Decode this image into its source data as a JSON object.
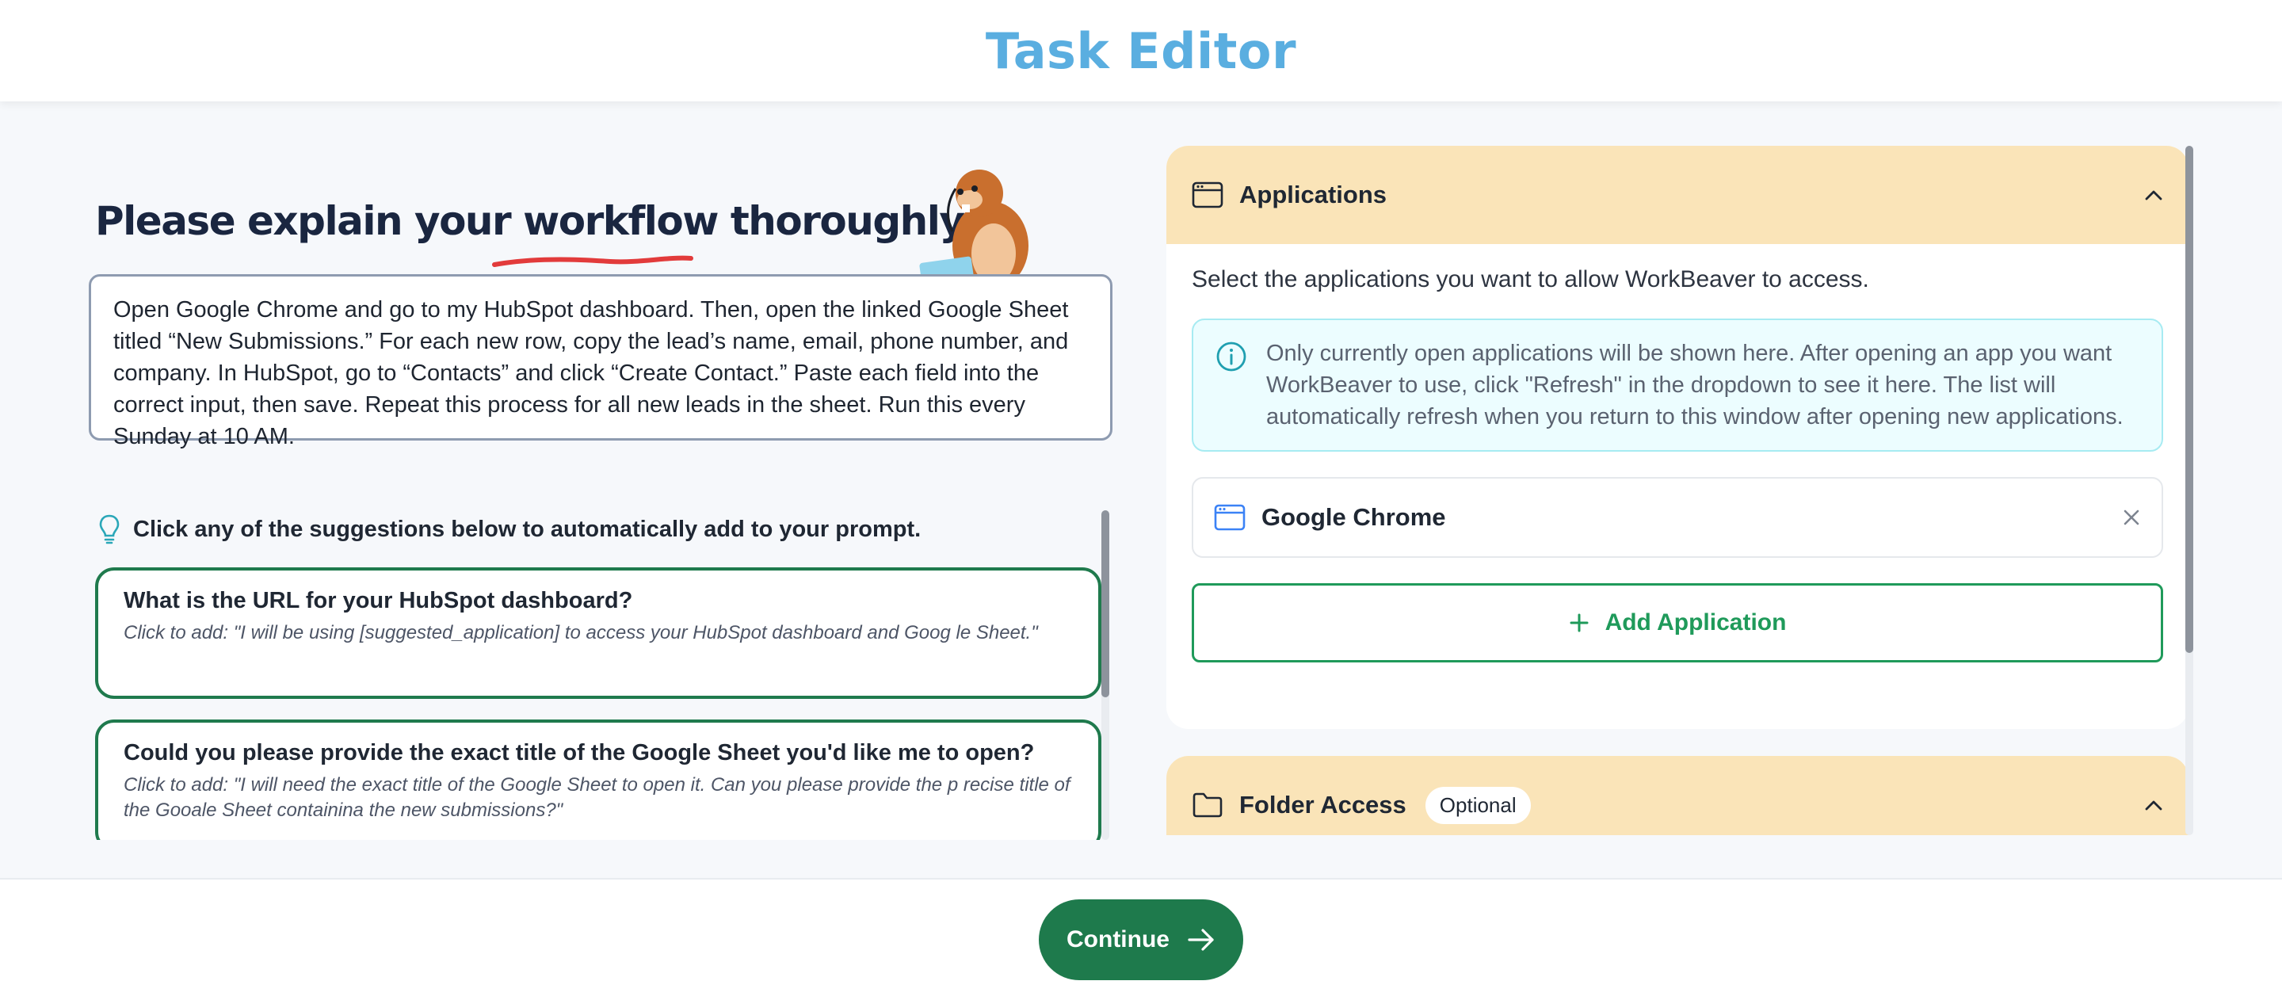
{
  "header": {
    "title": "Task Editor"
  },
  "left": {
    "headline": "Please explain your workflow thoroughly",
    "prompt_text": "Open Google Chrome and go to my HubSpot dashboard. Then, open the linked Google Sheet titled “New Submissions.” For each new row, copy the lead’s name, email, phone number, and company. In HubSpot, go to “Contacts” and click “Create Contact.” Paste each field into the correct input, then save. Repeat this process for all new leads in the sheet. Run this every Sunday at 10 AM.",
    "suggestions_header": "Click any of the suggestions below to automatically add to your prompt.",
    "suggestions": [
      {
        "title": "What is the URL for your HubSpot dashboard?",
        "body": "Click to add: \"I will be using [suggested_application] to access your HubSpot dashboard and Goog le Sheet.\""
      },
      {
        "title": "Could you please provide the exact title of the Google Sheet you'd like me to open?",
        "body": "Click to add: \"I will need the exact title of the Google Sheet to open it. Can you please provide the p recise title of the Gooale Sheet containina the new submissions?\""
      }
    ]
  },
  "applications": {
    "title": "Applications",
    "description": "Select the applications you want to allow WorkBeaver to access.",
    "info": "Only currently open applications will be shown here. After opening an app you want WorkBeaver to use, click \"Refresh\" in the dropdown to see it here. The list will automatically refresh when you return to this window after opening new applications.",
    "items": [
      {
        "name": "Google Chrome"
      }
    ],
    "add_label": "Add Application"
  },
  "folder_access": {
    "title": "Folder Access",
    "badge": "Optional"
  },
  "footer": {
    "continue_label": "Continue"
  },
  "colors": {
    "accent_green": "#1e7a4c",
    "panel_header": "#fae4b8",
    "title_blue": "#5aaee0"
  }
}
